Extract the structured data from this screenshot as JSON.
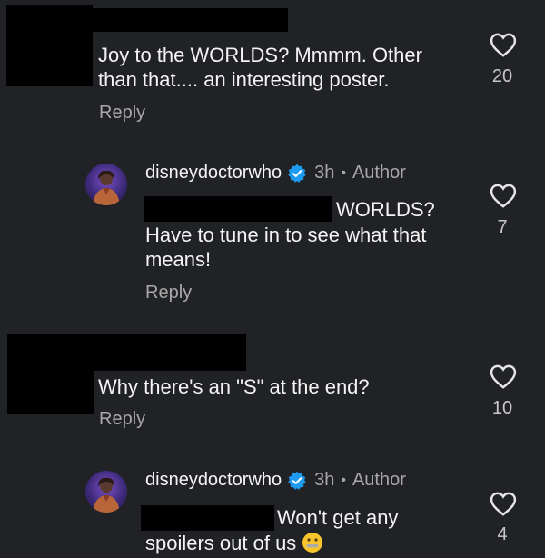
{
  "comments": [
    {
      "text": "Joy to the WORLDS? Mmmm. Other than that.... an interesting poster.",
      "text_line1": "Joy to the WORLDS? Mmmm. Other",
      "text_line2": "than that.... an interesting poster.",
      "reply_label": "Reply",
      "likes": "20"
    },
    {
      "username": "disneydoctorwho",
      "time": "3h",
      "separator": "•",
      "badge": "Author",
      "text_line1": "WORLDS?",
      "text_line2": "Have to tune in to see what that",
      "text_line3": "means!",
      "reply_label": "Reply",
      "likes": "7"
    },
    {
      "text": "Why there's an \"S\" at the end?",
      "reply_label": "Reply",
      "likes": "10"
    },
    {
      "username": "disneydoctorwho",
      "time": "3h",
      "separator": "•",
      "badge": "Author",
      "text_line1": "Won't get any",
      "text_line2": "spoilers out of us",
      "likes": "4"
    }
  ],
  "icons": {
    "like": "heart-outline-icon",
    "verified": "verified-badge-icon",
    "emoji": "zipper-mouth-face-emoji"
  },
  "colors": {
    "background": "#212225",
    "verified_blue": "#1d9bf0",
    "secondary_text": "#a8a8a8"
  }
}
